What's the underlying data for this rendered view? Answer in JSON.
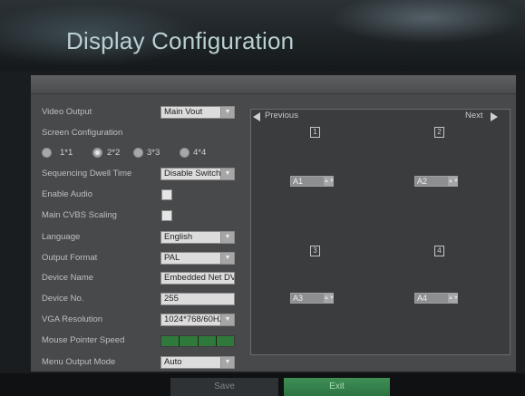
{
  "header": {
    "title": "Display Configuration"
  },
  "settings": {
    "video_output": {
      "label": "Video Output",
      "value": "Main Vout"
    },
    "screen_configuration": {
      "label": "Screen Configuration",
      "options": [
        "1*1",
        "2*2",
        "3*3",
        "4*4"
      ],
      "selected": "2*2"
    },
    "sequencing_dwell_time": {
      "label": "Sequencing Dwell Time",
      "value": "Disable Switch"
    },
    "enable_audio": {
      "label": "Enable Audio",
      "checked": false
    },
    "main_cvbs_scaling": {
      "label": "Main CVBS Scaling",
      "checked": false
    },
    "language": {
      "label": "Language",
      "value": "English"
    },
    "output_format": {
      "label": "Output Format",
      "value": "PAL"
    },
    "device_name": {
      "label": "Device Name",
      "value": "Embedded Net DVR"
    },
    "device_no": {
      "label": "Device No.",
      "value": "255"
    },
    "vga_resolution": {
      "label": "VGA Resolution",
      "value": "1024*768/60HZ"
    },
    "mouse_pointer_speed": {
      "label": "Mouse Pointer Speed",
      "level_fraction": 1.0
    },
    "menu_output_mode": {
      "label": "Menu Output Mode",
      "value": "Auto"
    }
  },
  "preview": {
    "previous_label": "Previous",
    "next_label": "Next",
    "windows": [
      {
        "number": "1",
        "channel": "A1"
      },
      {
        "number": "2",
        "channel": "A2"
      },
      {
        "number": "3",
        "channel": "A3"
      },
      {
        "number": "4",
        "channel": "A4"
      }
    ]
  },
  "footer": {
    "save_label": "Save",
    "exit_label": "Exit"
  },
  "colors": {
    "accent_green": "#2f7a3a",
    "title_color": "#b9cfd2"
  }
}
